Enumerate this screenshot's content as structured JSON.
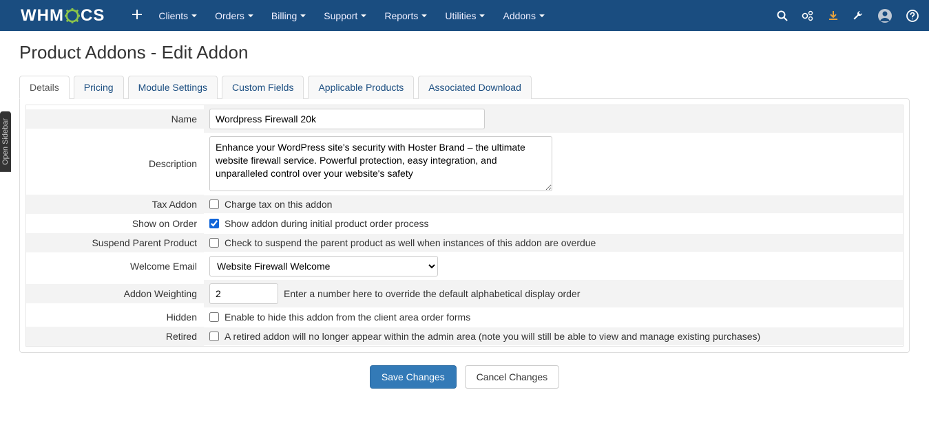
{
  "brand": {
    "pre": "WHM",
    "post": "CS"
  },
  "nav": {
    "items": [
      "Clients",
      "Orders",
      "Billing",
      "Support",
      "Reports",
      "Utilities",
      "Addons"
    ]
  },
  "sidebarTab": "Open Sidebar",
  "pageTitle": "Product Addons - Edit Addon",
  "tabs": [
    "Details",
    "Pricing",
    "Module Settings",
    "Custom Fields",
    "Applicable Products",
    "Associated Download"
  ],
  "form": {
    "name": {
      "label": "Name",
      "value": "Wordpress Firewall 20k"
    },
    "description": {
      "label": "Description",
      "value": "Enhance your WordPress site's security with Hoster Brand – the ultimate website firewall service. Powerful protection, easy integration, and unparalleled control over your website's safety"
    },
    "taxAddon": {
      "label": "Tax Addon",
      "text": "Charge tax on this addon",
      "checked": false
    },
    "showOnOrder": {
      "label": "Show on Order",
      "text": "Show addon during initial product order process",
      "checked": true
    },
    "suspendParent": {
      "label": "Suspend Parent Product",
      "text": "Check to suspend the parent product as well when instances of this addon are overdue",
      "checked": false
    },
    "welcomeEmail": {
      "label": "Welcome Email",
      "value": "Website Firewall Welcome"
    },
    "weighting": {
      "label": "Addon Weighting",
      "value": "2",
      "helper": "Enter a number here to override the default alphabetical display order"
    },
    "hidden": {
      "label": "Hidden",
      "text": "Enable to hide this addon from the client area order forms",
      "checked": false
    },
    "retired": {
      "label": "Retired",
      "text": "A retired addon will no longer appear within the admin area (note you will still be able to view and manage existing purchases)",
      "checked": false
    }
  },
  "buttons": {
    "save": "Save Changes",
    "cancel": "Cancel Changes"
  }
}
